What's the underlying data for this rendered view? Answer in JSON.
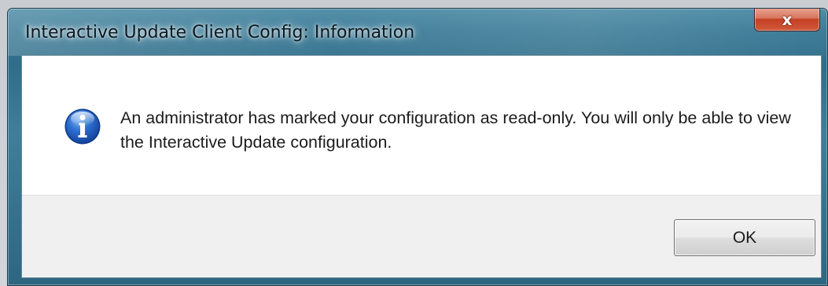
{
  "window": {
    "title": "Interactive Update Client Config: Information",
    "close_glyph": "x"
  },
  "dialog": {
    "icon": "info-icon",
    "message": "An administrator has marked your configuration as read-only.  You will only be able to view the Interactive Update configuration.",
    "ok_label": "OK"
  },
  "colors": {
    "titlebar_accent": "#2f6d89",
    "close_button": "#c43f22",
    "info_icon_blue": "#1f57b8"
  }
}
